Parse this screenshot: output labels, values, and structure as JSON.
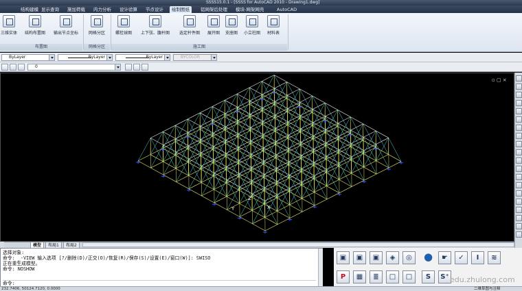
{
  "window": {
    "title": "SSSS15.0.1 - [SSSS for AutoCAD 2010 - Drawing1.dwg]"
  },
  "tabs": [
    {
      "label": "结构建模"
    },
    {
      "label": "显示查询"
    },
    {
      "label": "施加荷载"
    },
    {
      "label": "内力分析"
    },
    {
      "label": "设计验算"
    },
    {
      "label": "节点设计"
    },
    {
      "label": "绘制图纸",
      "active": true
    },
    {
      "label": "铝网架后处理"
    },
    {
      "label": "模块-网架网壳"
    },
    {
      "label": "AutoCAD"
    }
  ],
  "ribbon": {
    "groups": [
      {
        "label": "布置图",
        "buttons": [
          "三维实体",
          "结构布置图",
          "输出节点坐标"
        ]
      },
      {
        "label": "网格分区",
        "buttons": [
          "网格分区"
        ]
      },
      {
        "label": "施工图",
        "buttons": [
          "螺栓球图",
          "上下弦、腹杆图",
          "选定杆件图",
          "展开图",
          "支座图",
          "小立柱图",
          "材料表"
        ]
      }
    ]
  },
  "toolbar": {
    "color_combo": "ByLayer",
    "linetype_combo": "ByLayer",
    "lineweight_combo": "ByLayer",
    "plotstyle_combo": "BYCOLOR",
    "layer_combo": "0"
  },
  "layout_tabs": [
    {
      "label": "模型",
      "active": true
    },
    {
      "label": "布局1"
    },
    {
      "label": "布局2"
    }
  ],
  "command": {
    "lines": [
      "选择对象:",
      "命令: _-VIEW 输入选项 [?/删除(D)/正交(O)/恢复(R)/保存(S)/设置(E)/窗口(W)]: SWISO",
      "正在重生成模型。",
      "命令: NOSHOW",
      "",
      "命令:"
    ]
  },
  "statusbar": {
    "coords": "232.7406, 50124.7120, 0.0000",
    "right_label": "二维草图与注释"
  },
  "watermark": "edu.zhulong.com",
  "viewport": {
    "axis_label_z": "Z",
    "axis_label_x": "X",
    "axis_label_y": "Y"
  },
  "colors": {
    "grid_yellow": "#e8e86a",
    "grid_cyan": "#58d7d4",
    "grid_white": "#eaeaea",
    "grid_blue": "#3f52ff",
    "ribbon_bg": "#e7edf5"
  },
  "icon_panel": {
    "icons": [
      "cube-icon",
      "cube-icon",
      "cube-icon",
      "cube-icon",
      "cube-icon",
      "sphere-icon",
      "hand-icon",
      "checkbox-icon",
      "text-cursor-icon",
      "layers-icon",
      "pdf-icon",
      "block-icon",
      "stack-icon",
      "square-icon",
      "s-icon",
      "s-plus-icon"
    ]
  }
}
